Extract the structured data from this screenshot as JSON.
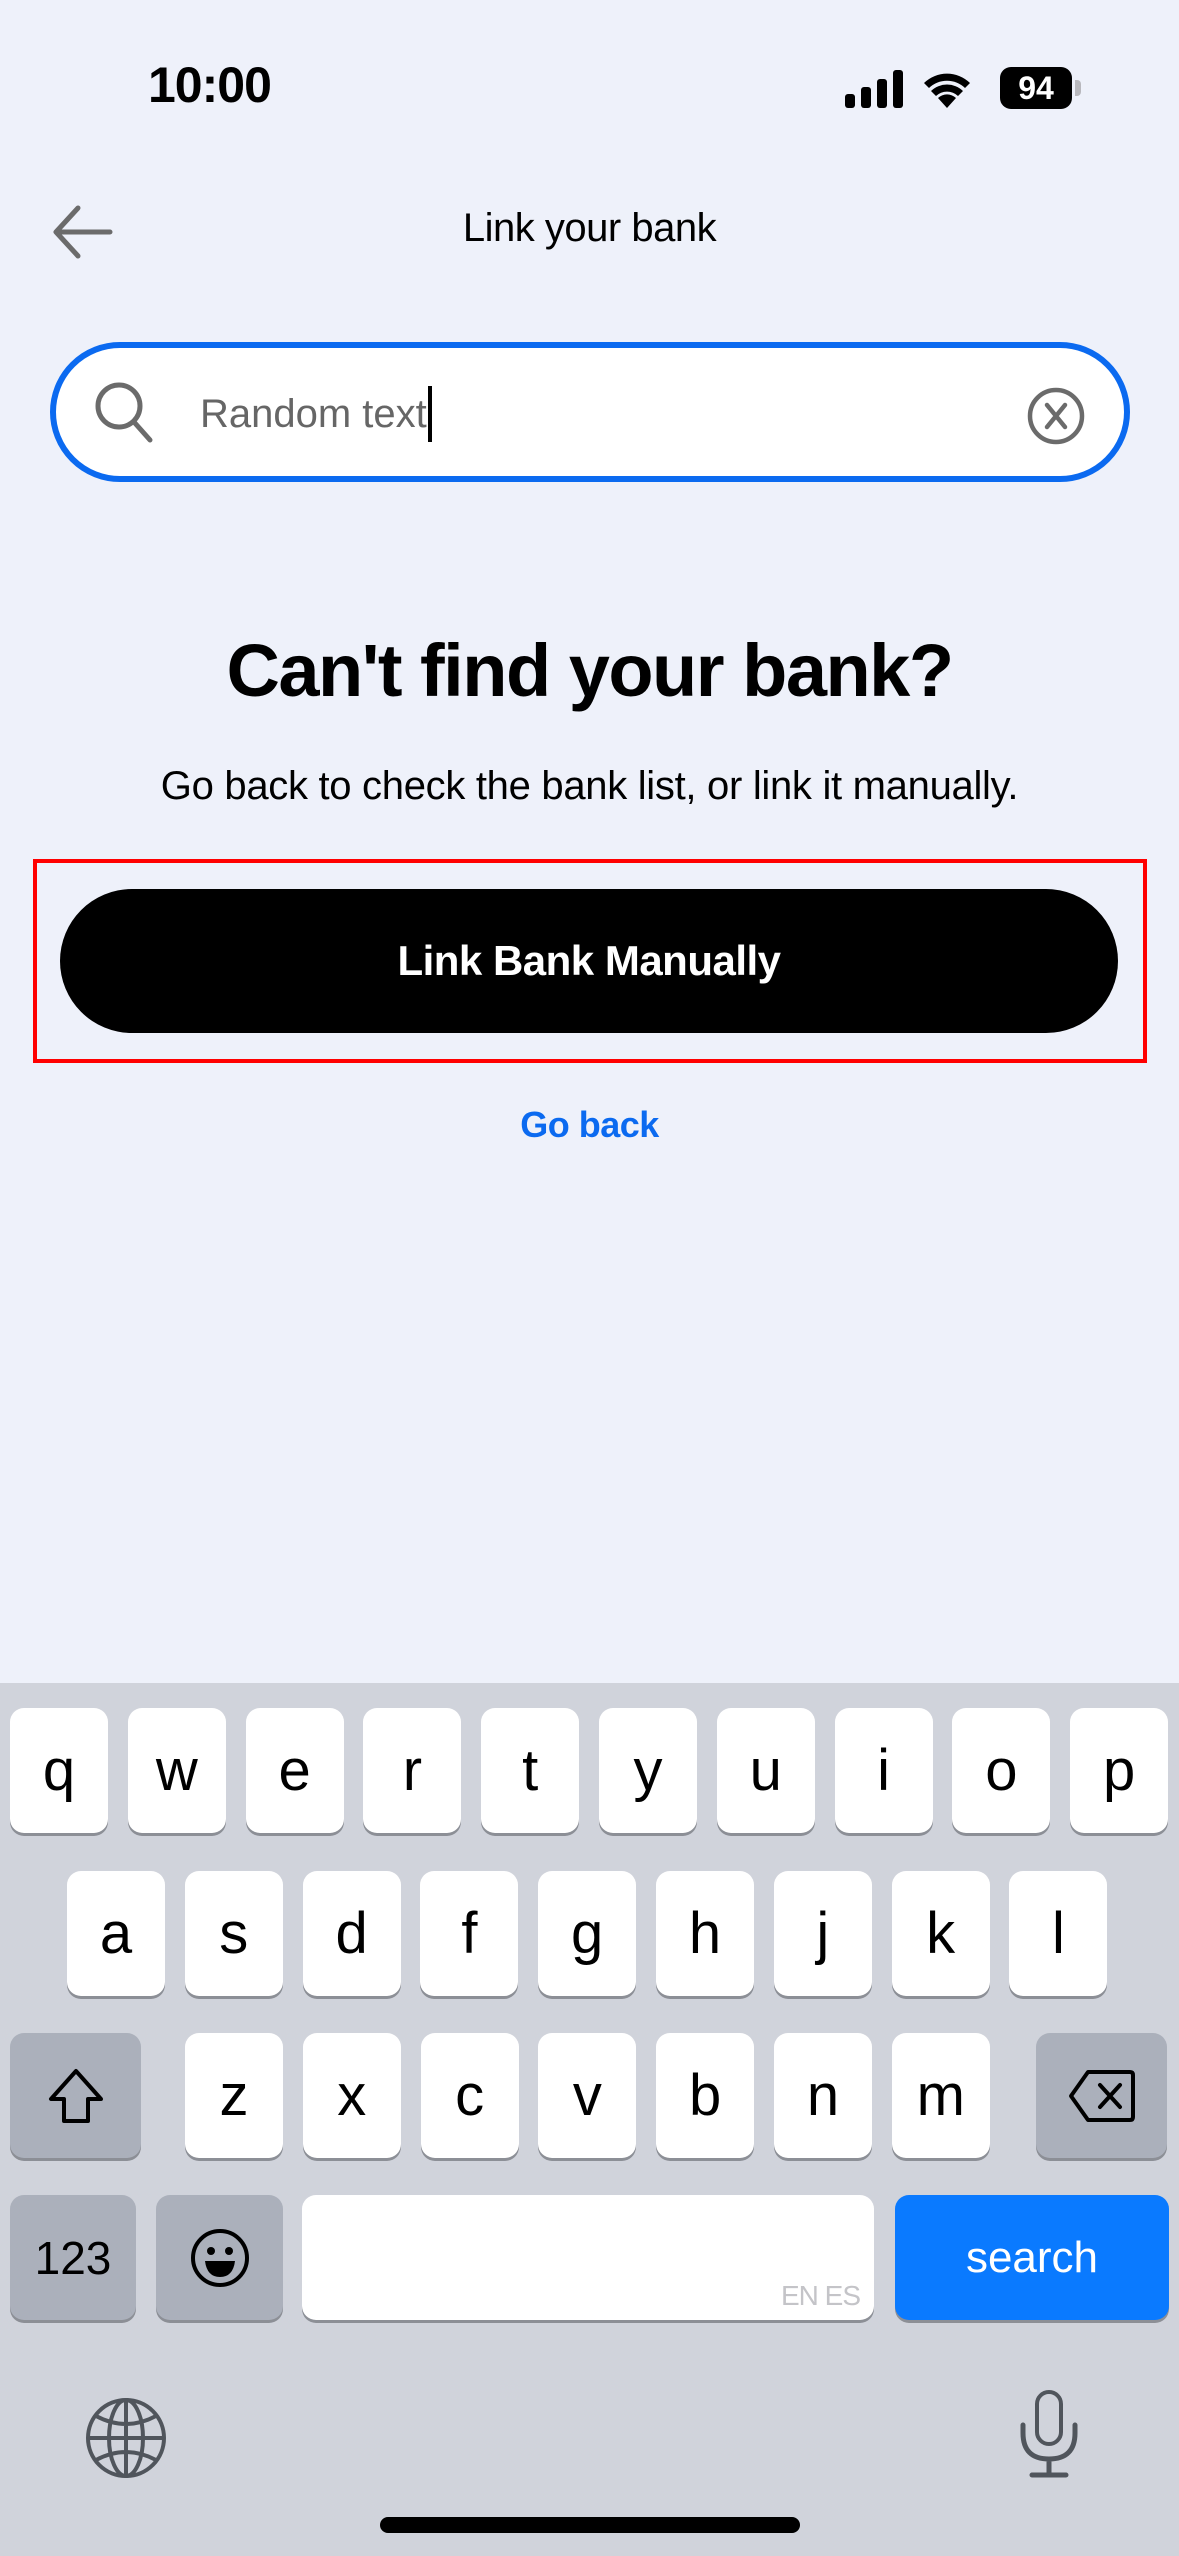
{
  "status_bar": {
    "time": "10:00",
    "battery_level": "94",
    "icons": [
      "signal-icon",
      "wifi-icon",
      "battery-icon"
    ]
  },
  "header": {
    "title": "Link your bank",
    "back_icon": "arrow-left-icon"
  },
  "search": {
    "value": "Random text",
    "icon": "search-icon",
    "clear_icon": "clear-circle-x-icon"
  },
  "empty_state": {
    "heading": "Can't find your bank?",
    "description": "Go back to check the bank list, or link it manually.",
    "primary_button": "Link Bank Manually",
    "secondary_link": "Go back"
  },
  "keyboard": {
    "row1": [
      "q",
      "w",
      "e",
      "r",
      "t",
      "y",
      "u",
      "i",
      "o",
      "p"
    ],
    "row2": [
      "a",
      "s",
      "d",
      "f",
      "g",
      "h",
      "j",
      "k",
      "l"
    ],
    "row3": [
      "z",
      "x",
      "c",
      "v",
      "b",
      "n",
      "m"
    ],
    "numbers_key": "123",
    "space_hint": "EN ES",
    "action_key": "search",
    "icons": [
      "shift-icon",
      "delete-icon",
      "emoji-icon",
      "globe-icon",
      "microphone-icon"
    ]
  },
  "colors": {
    "accent": "#0b6af0",
    "background": "#eef1fa",
    "keyboard_bg": "#d0d3db",
    "highlight": "#ff0000",
    "action_key": "#0a7aff"
  }
}
